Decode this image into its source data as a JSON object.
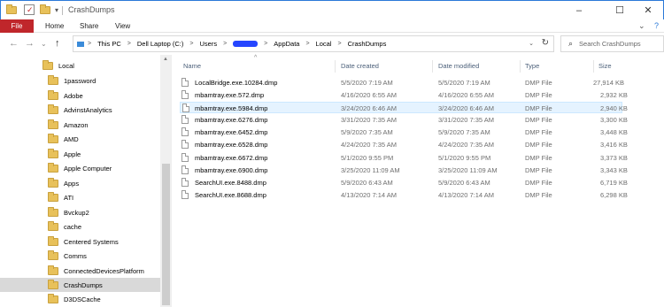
{
  "window": {
    "title": "CrashDumps",
    "controls": {
      "minimize": "–",
      "maximize": "☐",
      "close": "✕"
    }
  },
  "ribbon": {
    "file_tab": "File",
    "tabs": [
      "Home",
      "Share",
      "View"
    ],
    "expand_glyph": "⌄",
    "help_glyph": "?"
  },
  "nav": {
    "back": "←",
    "forward": "→",
    "recent": "⌄",
    "up": "↑"
  },
  "address": {
    "root": "This PC",
    "drive": "Dell Laptop (C:)",
    "users": "Users",
    "appdata": "AppData",
    "local": "Local",
    "current": "CrashDumps",
    "sep": ">"
  },
  "search": {
    "placeholder": "Search CrashDumps",
    "icon": "search-icon"
  },
  "sidebar": {
    "items": [
      "Local",
      "1password",
      "Adobe",
      "AdvinstAnalytics",
      "Amazon",
      "AMD",
      "Apple",
      "Apple Computer",
      "Apps",
      "ATI",
      "Bvckup2",
      "cache",
      "Centered Systems",
      "Comms",
      "ConnectedDevicesPlatform",
      "CrashDumps",
      "D3DSCache"
    ],
    "selected": "CrashDumps"
  },
  "columns": {
    "name": "Name",
    "date_created": "Date created",
    "date_modified": "Date modified",
    "type": "Type",
    "size": "Size"
  },
  "files": [
    {
      "name": "LocalBridge.exe.10284.dmp",
      "created": "5/5/2020 7:19 AM",
      "modified": "5/5/2020 7:19 AM",
      "type": "DMP File",
      "size": "27,914 KB"
    },
    {
      "name": "mbamtray.exe.572.dmp",
      "created": "4/16/2020 6:55 AM",
      "modified": "4/16/2020 6:55 AM",
      "type": "DMP File",
      "size": "2,932 KB"
    },
    {
      "name": "mbamtray.exe.5984.dmp",
      "created": "3/24/2020 6:46 AM",
      "modified": "3/24/2020 6:46 AM",
      "type": "DMP File",
      "size": "2,940 KB"
    },
    {
      "name": "mbamtray.exe.6276.dmp",
      "created": "3/31/2020 7:35 AM",
      "modified": "3/31/2020 7:35 AM",
      "type": "DMP File",
      "size": "3,300 KB"
    },
    {
      "name": "mbamtray.exe.6452.dmp",
      "created": "5/9/2020 7:35 AM",
      "modified": "5/9/2020 7:35 AM",
      "type": "DMP File",
      "size": "3,448 KB"
    },
    {
      "name": "mbamtray.exe.6528.dmp",
      "created": "4/24/2020 7:35 AM",
      "modified": "4/24/2020 7:35 AM",
      "type": "DMP File",
      "size": "3,416 KB"
    },
    {
      "name": "mbamtray.exe.6672.dmp",
      "created": "5/1/2020 9:55 PM",
      "modified": "5/1/2020 9:55 PM",
      "type": "DMP File",
      "size": "3,373 KB"
    },
    {
      "name": "mbamtray.exe.6900.dmp",
      "created": "3/25/2020 11:09 AM",
      "modified": "3/25/2020 11:09 AM",
      "type": "DMP File",
      "size": "3,343 KB"
    },
    {
      "name": "SearchUI.exe.8488.dmp",
      "created": "5/9/2020 6:43 AM",
      "modified": "5/9/2020 6:43 AM",
      "type": "DMP File",
      "size": "6,719 KB"
    },
    {
      "name": "SearchUI.exe.8688.dmp",
      "created": "4/13/2020 7:14 AM",
      "modified": "4/13/2020 7:14 AM",
      "type": "DMP File",
      "size": "6,298 KB"
    }
  ],
  "highlighted_row": "mbamtray.exe.5984.dmp",
  "colors": {
    "file_tab": "#c0262b",
    "selection": "#e5f3ff",
    "header_text": "#4c607a",
    "redaction": "#2545ff"
  }
}
